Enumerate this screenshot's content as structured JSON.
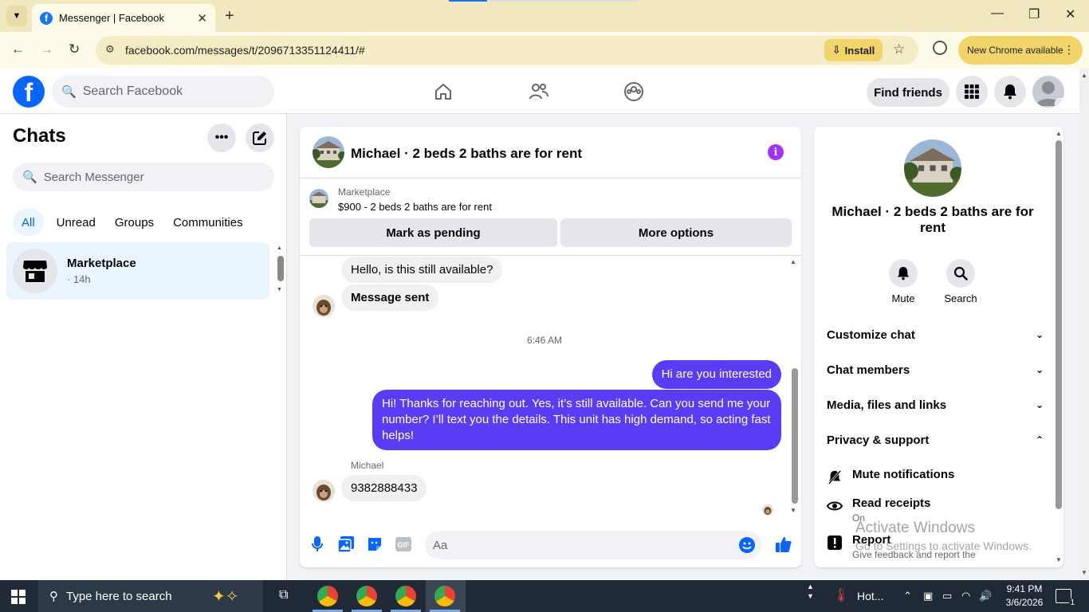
{
  "browser": {
    "tab_title": "Messenger | Facebook",
    "url": "facebook.com/messages/t/2096713351124411/#",
    "install_label": "Install",
    "new_chrome_label": "New Chrome available"
  },
  "fb": {
    "search_placeholder": "Search Facebook",
    "find_friends": "Find friends"
  },
  "sidebar": {
    "title": "Chats",
    "search_placeholder": "Search Messenger",
    "filters": [
      "All",
      "Unread",
      "Groups",
      "Communities"
    ],
    "chats": [
      {
        "name": "Marketplace",
        "time": "· 14h"
      }
    ]
  },
  "conversation": {
    "title": "Michael · 2 beds 2 baths are for rent",
    "marketplace_label": "Marketplace",
    "listing": "$900 - 2 beds 2 baths are for rent",
    "mark_pending": "Mark as pending",
    "more_options": "More options",
    "messages": [
      {
        "from": "them",
        "text": "Hello, is this still available?"
      },
      {
        "from": "them",
        "text": "Message sent"
      },
      {
        "from": "me",
        "text": "Hi are you interested"
      },
      {
        "from": "me",
        "text": "Hi! Thanks for reaching out. Yes, it’s still available. Can you send me your number? I’ll text you the details. This unit has high demand, so acting fast helps!"
      },
      {
        "from": "them",
        "text": "9382888433"
      }
    ],
    "timestamp": "6:46 AM",
    "sender_label": "Michael",
    "composer_placeholder": "Aa"
  },
  "info": {
    "name": "Michael · 2 beds 2 baths are for rent",
    "mute": "Mute",
    "search": "Search",
    "sections": [
      "Customize chat",
      "Chat members",
      "Media, files and links",
      "Privacy & support"
    ],
    "privacy_items": [
      {
        "title": "Mute notifications",
        "sub": ""
      },
      {
        "title": "Read receipts",
        "sub": "On"
      },
      {
        "title": "Report",
        "sub": "Give feedback and report the"
      }
    ]
  },
  "watermark": {
    "line1": "Activate Windows",
    "line2": "Go to Settings to activate Windows."
  },
  "taskbar": {
    "search_placeholder": "Type here to search",
    "weather": "Hot...",
    "time": "9:41 PM",
    "date": "3/6/2026",
    "notif_count": "1"
  },
  "colors": {
    "fb_blue": "#0866ff",
    "outgoing_bubble": "#5b3cf5",
    "info_purple": "#a033ff",
    "chrome_tabstrip": "#f2e8bf",
    "chrome_install": "#f1d56b"
  }
}
